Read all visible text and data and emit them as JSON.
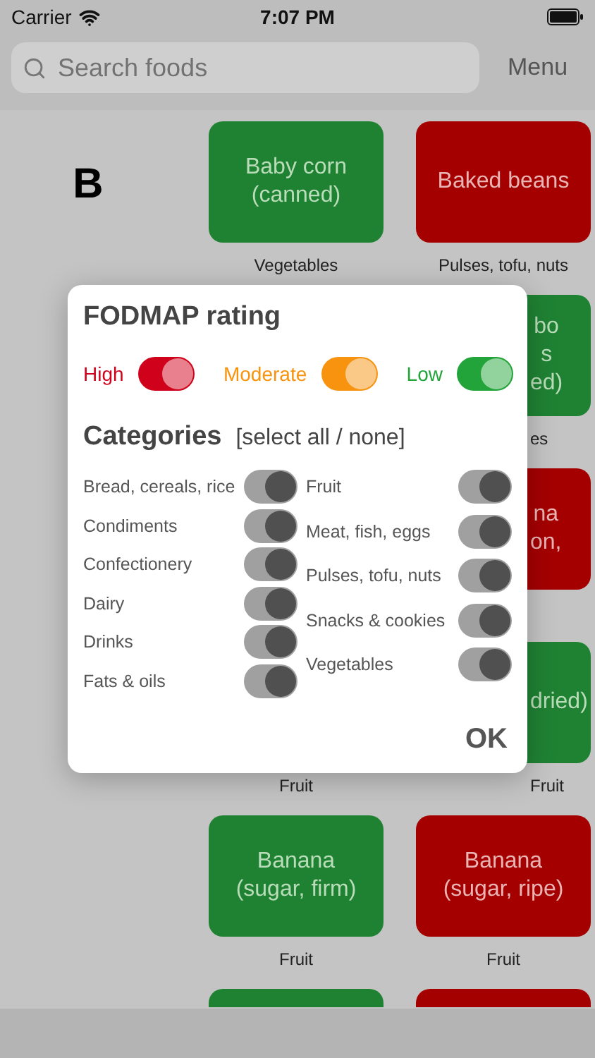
{
  "status_bar": {
    "carrier": "Carrier",
    "time": "7:07 PM"
  },
  "search": {
    "placeholder": "Search foods"
  },
  "menu": "Menu",
  "rows": [
    {
      "letter": "B",
      "items": [
        {
          "kind": "tile",
          "color": "#1f8233",
          "lines": [
            "Baby corn",
            "(canned)"
          ],
          "caption": "Vegetables"
        },
        {
          "kind": "tile",
          "color": "#a50000",
          "lines": [
            "Baked beans"
          ],
          "caption": "Pulses, tofu, nuts"
        }
      ]
    },
    {
      "items": [
        {
          "kind": "covered"
        },
        {
          "kind": "partial",
          "color": "#1f8233",
          "lines": [
            "bo",
            "s",
            "ed)"
          ],
          "caption": "es"
        }
      ]
    },
    {
      "items": [
        {
          "kind": "covered"
        },
        {
          "kind": "partial",
          "color": "#a50000",
          "lines": [
            "na",
            "on,"
          ]
        }
      ]
    },
    {
      "items": [
        {
          "kind": "covered",
          "caption": "Fruit"
        },
        {
          "kind": "partial",
          "color": "#1f8233",
          "lines": [
            "dried)"
          ],
          "caption": "Fruit"
        }
      ]
    },
    {
      "items": [
        {
          "kind": "tile",
          "color": "#1f8233",
          "lines": [
            "Banana",
            "(sugar, firm)"
          ],
          "caption": "Fruit"
        },
        {
          "kind": "tile",
          "color": "#a50000",
          "lines": [
            "Banana",
            "(sugar, ripe)"
          ],
          "caption": "Fruit"
        }
      ]
    },
    {
      "items": [
        {
          "kind": "stub",
          "color": "#1f8233"
        },
        {
          "kind": "stub",
          "color": "#a50000"
        }
      ]
    }
  ],
  "dialog": {
    "title": "FODMAP rating",
    "ratings": [
      {
        "label": "High",
        "color": "#d0021b",
        "on": true
      },
      {
        "label": "Moderate",
        "color": "#f7930e",
        "on": true
      },
      {
        "label": "Low",
        "color": "#22a43a",
        "on": true
      }
    ],
    "categories_title": "Categories",
    "select_link": "[select all / none]",
    "categories_left": [
      {
        "label": "Bread, cereals, rice",
        "on": true
      },
      {
        "label": "Condiments",
        "on": true
      },
      {
        "label": "Confectionery",
        "on": true
      },
      {
        "label": "Dairy",
        "on": true
      },
      {
        "label": "Drinks",
        "on": true
      },
      {
        "label": "Fats & oils",
        "on": true
      }
    ],
    "categories_right": [
      {
        "label": "Fruit",
        "on": true
      },
      {
        "label": "Meat, fish, eggs",
        "on": true
      },
      {
        "label": "Pulses, tofu, nuts",
        "on": true
      },
      {
        "label": "Snacks & cookies",
        "on": true
      },
      {
        "label": "Vegetables",
        "on": true
      }
    ],
    "ok": "OK"
  }
}
